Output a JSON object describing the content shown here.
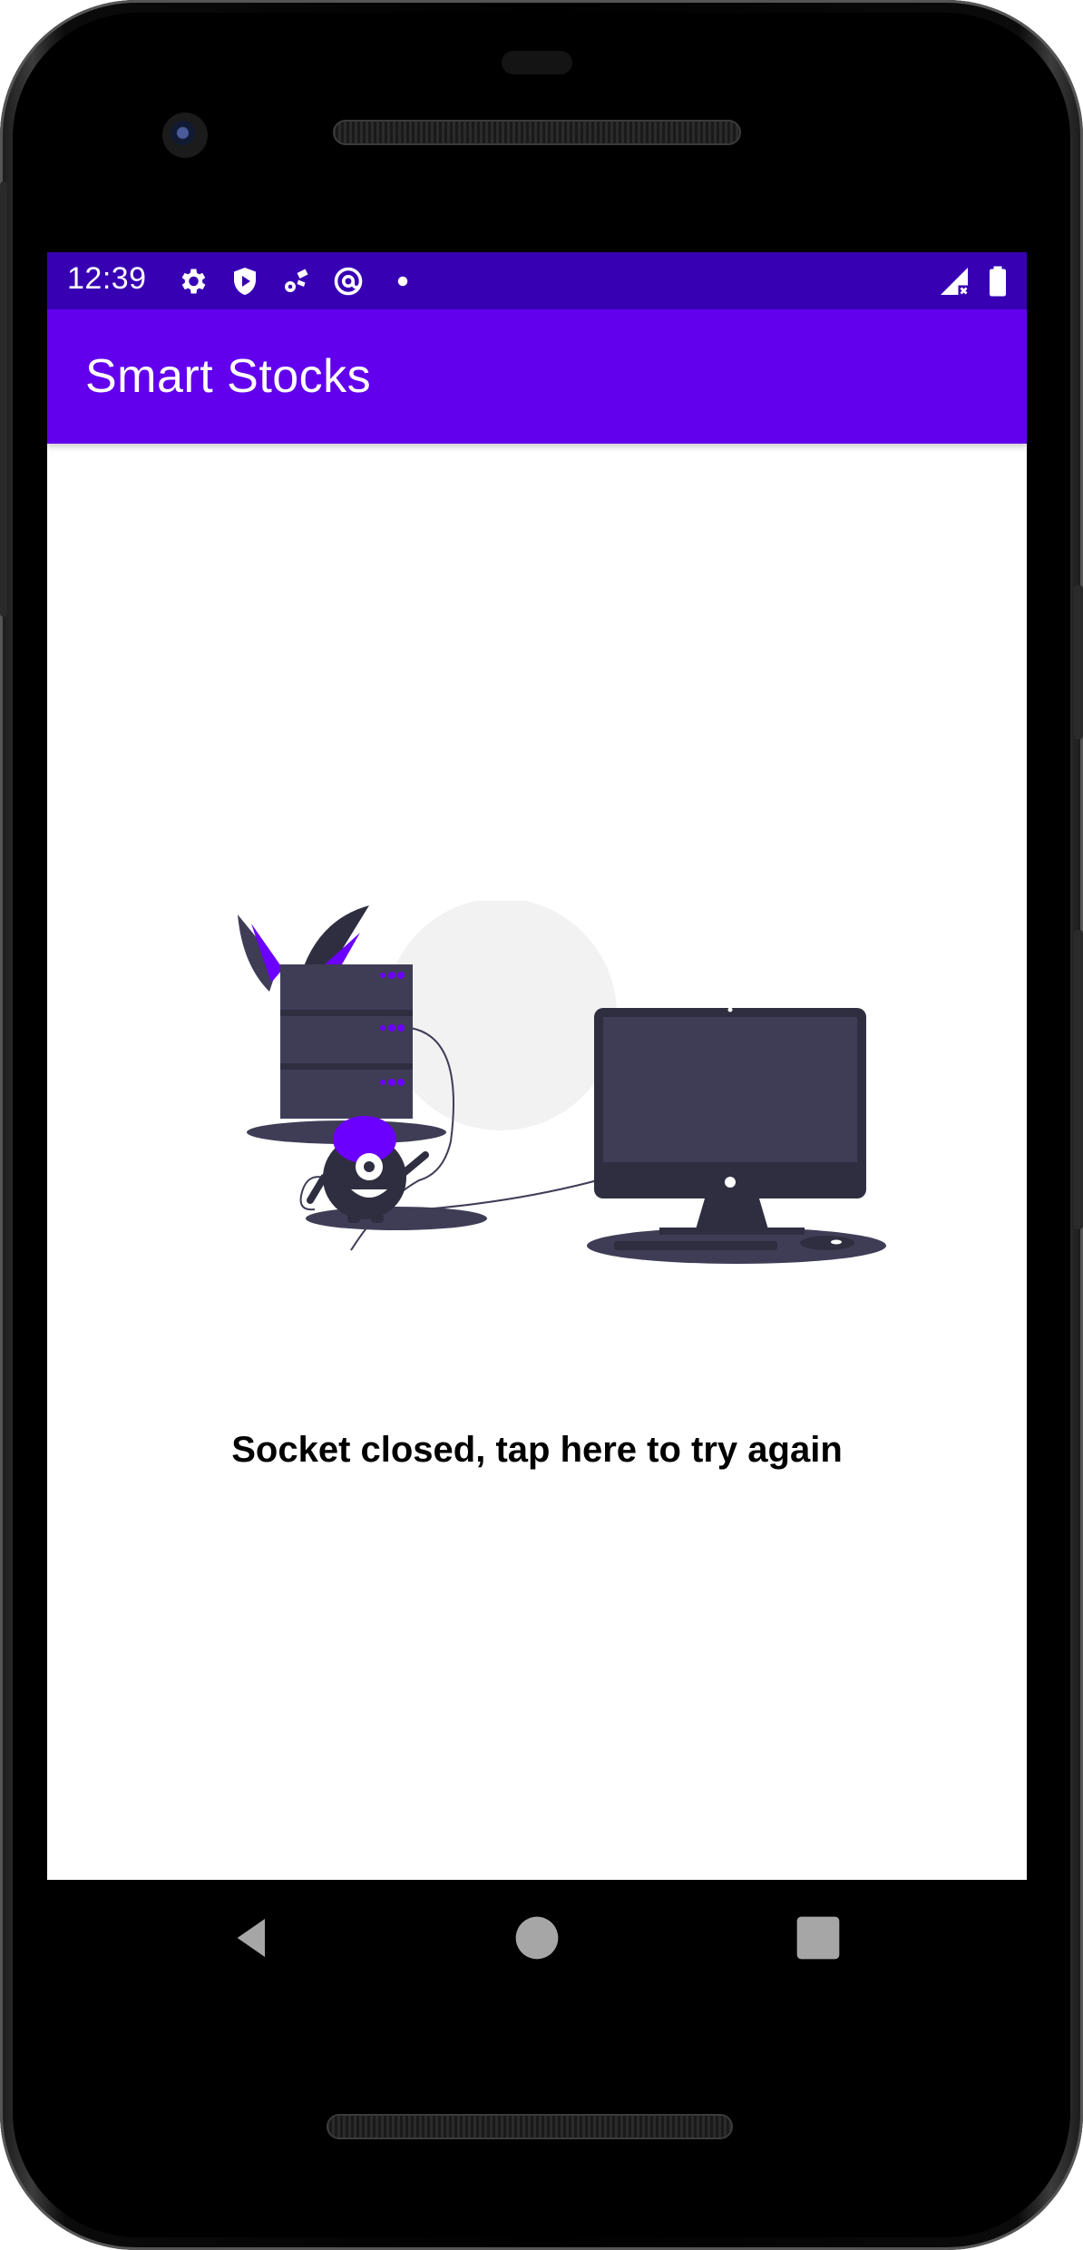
{
  "status_bar": {
    "time": "12:39",
    "left_icons": [
      "settings-icon",
      "shield-play-icon",
      "sync-icon",
      "at-sign-icon",
      "dot-icon"
    ],
    "right_icons": [
      "signal-off-icon",
      "battery-icon"
    ]
  },
  "app_bar": {
    "title": "Smart Stocks"
  },
  "main": {
    "illustration": "server-monitor-error-illustration",
    "message": "Socket closed, tap here to try again"
  },
  "nav_bar": {
    "buttons": [
      "back-icon",
      "home-icon",
      "recents-icon"
    ]
  },
  "colors": {
    "status_bar": "#3700b3",
    "app_bar": "#6200ee",
    "accent": "#6c00ff",
    "illustration_dark": "#3f3d56",
    "illustration_base": "#2f2e41"
  }
}
